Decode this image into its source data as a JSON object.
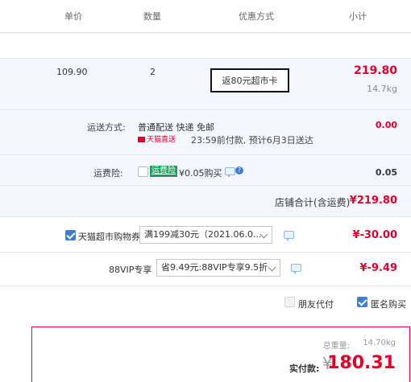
{
  "columns": {
    "unit_price": "单价",
    "quantity": "数量",
    "discount": "优惠方式",
    "subtotal": "小计"
  },
  "item": {
    "unit_price": "109.90",
    "quantity": "2",
    "discount_tag": "返80元超市卡",
    "subtotal": "219.80",
    "weight": "14.7kg"
  },
  "shipping": {
    "label": "运送方式:",
    "method": "普通配送 快递 免邮",
    "badge": "天猫直送",
    "note": "23:59前付款, 预计6月3日送达",
    "price": "0.00"
  },
  "insurance": {
    "label": "运费险:",
    "badge": "运费险",
    "desc": "¥0.05购买",
    "price": "0.05",
    "checked": false
  },
  "store_total": {
    "label": "店铺合计(含运费)",
    "value": "¥219.80"
  },
  "coupon": {
    "label": "天猫超市购物券",
    "option": "满199减30元（2021.06.0...",
    "value": "¥-30.00",
    "checked": true
  },
  "vip": {
    "label": "88VIP专享",
    "option": "省9.49元:88VIP专享9.5折",
    "value": "¥-9.49"
  },
  "options": {
    "pay_for_friend": "朋友代付",
    "pay_for_friend_checked": false,
    "anonymous": "匿名购买",
    "anonymous_checked": true
  },
  "summary": {
    "weight_label": "总重量:",
    "weight_value": "14.70kg",
    "pay_label": "实付款:",
    "currency": "¥",
    "amount": "180.31"
  },
  "colors": {
    "accent_red": "#e4002b",
    "link_blue": "#3d7edb",
    "row_bg": "#f4f8fe"
  }
}
